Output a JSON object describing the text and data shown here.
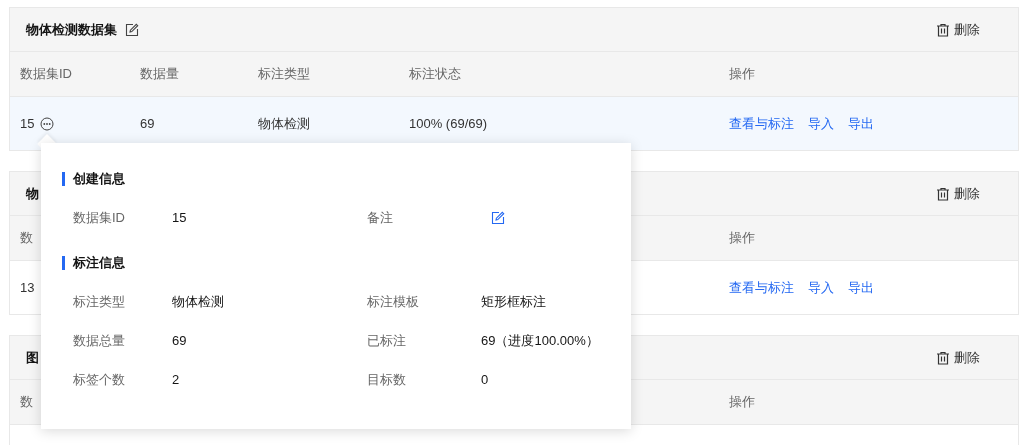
{
  "datasets": [
    {
      "title": "物体检测数据集",
      "title_editable": true,
      "delete": "删除",
      "header": {
        "id": "数据集ID",
        "count": "数据量",
        "type": "标注类型",
        "status": "标注状态",
        "actions": "操作"
      },
      "row": {
        "highlighted": true,
        "id": "15",
        "count": "69",
        "type": "物体检测",
        "status": "100% (69/69)",
        "actions": [
          "查看与标注",
          "导入",
          "导出"
        ]
      }
    },
    {
      "title": "物",
      "delete": "删除",
      "header": {
        "id": "数",
        "actions": "操作"
      },
      "row": {
        "id": "13",
        "actions": [
          "查看与标注",
          "导入",
          "导出"
        ]
      }
    },
    {
      "title": "图",
      "delete": "删除",
      "header": {
        "id": "数",
        "actions": "操作"
      }
    }
  ],
  "details": {
    "sections": [
      {
        "title": "创建信息",
        "fields": [
          {
            "label": "数据集ID",
            "kind": "text",
            "value": "15"
          },
          {
            "label": "备注",
            "kind": "edit"
          }
        ]
      },
      {
        "title": "标注信息",
        "fields": [
          {
            "label": "标注类型",
            "kind": "text",
            "value": "物体检测"
          },
          {
            "label": "标注模板",
            "kind": "text",
            "value": "矩形框标注"
          },
          {
            "label": "数据总量",
            "kind": "text",
            "value": "69"
          },
          {
            "label": "已标注",
            "kind": "text",
            "value": "69（进度100.00%）"
          },
          {
            "label": "标签个数",
            "kind": "text",
            "value": "2"
          },
          {
            "label": "目标数",
            "kind": "text",
            "value": "0"
          }
        ]
      }
    ]
  }
}
